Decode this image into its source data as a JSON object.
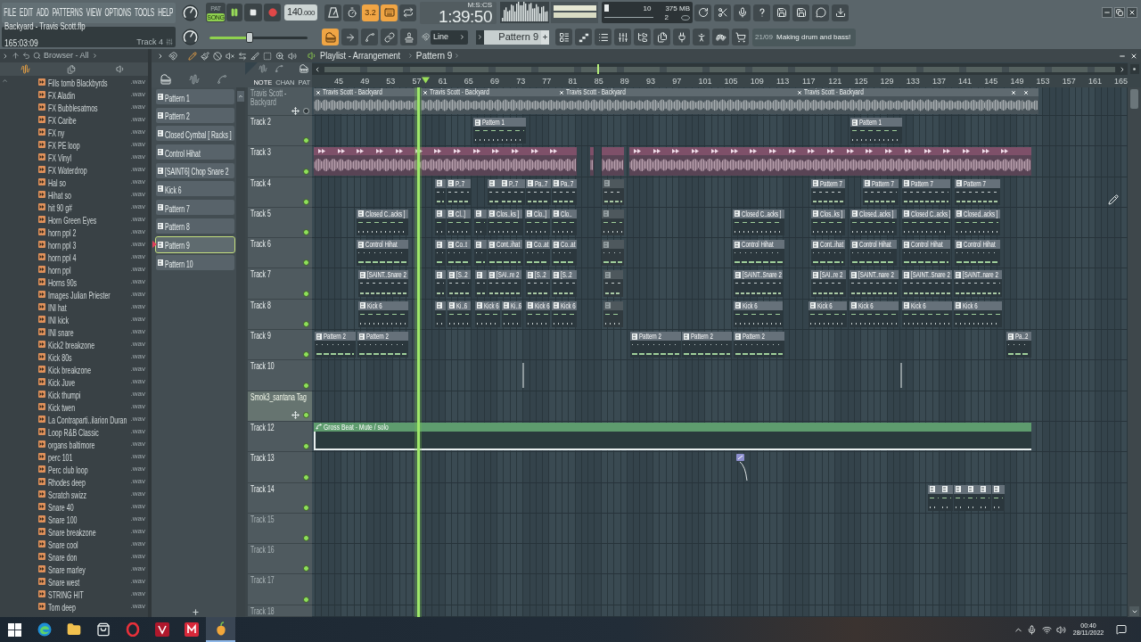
{
  "menu": [
    "FILE",
    "EDIT",
    "ADD",
    "PATTERNS",
    "VIEW",
    "OPTIONS",
    "TOOLS",
    "HELP"
  ],
  "transport": {
    "modes": [
      {
        "label": "PAT",
        "selected": false
      },
      {
        "label": "SONG",
        "selected": true
      }
    ],
    "playing": true,
    "tempo": "140.000"
  },
  "record_toggles": [
    {
      "on": false
    },
    {
      "on": false
    },
    {
      "label": "3.2",
      "on": true
    },
    {
      "on": true
    },
    {
      "on": false
    }
  ],
  "clock": {
    "time": "1:39:50",
    "unit": "M:S:CS"
  },
  "monitor": {
    "cpu": "10",
    "memory": "375 MB",
    "voices": "2"
  },
  "song": {
    "file": "Backyard - Travis Scott.flp",
    "position": "165:03:09",
    "track": "Track 4"
  },
  "pitch": {
    "level": 0.41
  },
  "edit_toggles": [
    {
      "on": true
    },
    {
      "on": false
    },
    {
      "on": false
    },
    {
      "on": false
    },
    {
      "on": false
    }
  ],
  "snap": {
    "value": "Line"
  },
  "pattern_selector": {
    "value": "Pattern 9"
  },
  "hint": {
    "counter": "21/09",
    "text": "Making drum and bass!"
  },
  "browser": {
    "title": "Browser - All",
    "items": [
      {
        "name": "Fills tomb Blackbyrds",
        "ext": ".wav"
      },
      {
        "name": "FX Aladin",
        "ext": ".wav"
      },
      {
        "name": "FX Bubblesatmos",
        "ext": ".wav"
      },
      {
        "name": "FX Caribe",
        "ext": ".wav"
      },
      {
        "name": "FX ny",
        "ext": ".wav"
      },
      {
        "name": "FX PE loop",
        "ext": ".wav"
      },
      {
        "name": "FX Vinyl",
        "ext": ".wav"
      },
      {
        "name": "FX Waterdrop",
        "ext": ".wav"
      },
      {
        "name": "Hal so",
        "ext": ".wav"
      },
      {
        "name": "Hihat so",
        "ext": ".wav"
      },
      {
        "name": "hit 90 g#",
        "ext": ".wav"
      },
      {
        "name": "Horn Green Eyes",
        "ext": ".wav"
      },
      {
        "name": "horn ppl 2",
        "ext": ".wav"
      },
      {
        "name": "horn ppl 3",
        "ext": ".wav"
      },
      {
        "name": "horn ppl 4",
        "ext": ".wav"
      },
      {
        "name": "horn ppl",
        "ext": ".wav"
      },
      {
        "name": "Horns 90s",
        "ext": ".wav"
      },
      {
        "name": "Images Julian Priester",
        "ext": ".wav"
      },
      {
        "name": "INI hat",
        "ext": ".wav"
      },
      {
        "name": "INI kick",
        "ext": ".wav"
      },
      {
        "name": "INI snare",
        "ext": ".wav"
      },
      {
        "name": "Kick2 breakzone",
        "ext": ".wav"
      },
      {
        "name": "Kick 80s",
        "ext": ".wav"
      },
      {
        "name": "Kick breakzone",
        "ext": ".wav"
      },
      {
        "name": "Kick Juve",
        "ext": ".wav"
      },
      {
        "name": "Kick thumpi",
        "ext": ".wav"
      },
      {
        "name": "Kick twen",
        "ext": ".wav"
      },
      {
        "name": "La Contraparti..ilarion Duran",
        "ext": ".wav"
      },
      {
        "name": "Loop R&B Classic",
        "ext": ".wav"
      },
      {
        "name": "organs baltimore",
        "ext": ".wav"
      },
      {
        "name": "perc 101",
        "ext": ".wav"
      },
      {
        "name": "Perc club loop",
        "ext": ".wav"
      },
      {
        "name": "Rhodes deep",
        "ext": ".wav"
      },
      {
        "name": "Scratch swizz",
        "ext": ".wav"
      },
      {
        "name": "Snare 40",
        "ext": ".wav"
      },
      {
        "name": "Snare 100",
        "ext": ".wav"
      },
      {
        "name": "Snare breakzone",
        "ext": ".wav"
      },
      {
        "name": "Snare cool",
        "ext": ".wav"
      },
      {
        "name": "Snare don",
        "ext": ".wav"
      },
      {
        "name": "Snare marley",
        "ext": ".wav"
      },
      {
        "name": "Snare west",
        "ext": ".wav"
      },
      {
        "name": "STRING HIT",
        "ext": ".wav"
      },
      {
        "name": "Tom deep",
        "ext": ".wav"
      }
    ]
  },
  "playlist": {
    "title": "Playlist - Arrangement",
    "pattern": "Pattern 9",
    "patterns": [
      {
        "name": "Pattern 1",
        "selected": false
      },
      {
        "name": "Pattern 2",
        "selected": false
      },
      {
        "name": "Closed Cymbal [ Racks ]",
        "selected": false
      },
      {
        "name": "Control Hihat",
        "selected": false
      },
      {
        "name": "[SAINT6] Chop Snare 2",
        "selected": false
      },
      {
        "name": "Kick 6",
        "selected": false
      },
      {
        "name": "Pattern 7",
        "selected": false
      },
      {
        "name": "Pattern 8",
        "selected": false
      },
      {
        "name": "Pattern 9",
        "selected": true
      },
      {
        "name": "Pattern 10",
        "selected": false
      }
    ],
    "modes": [
      {
        "label": "NOTE",
        "selected": true
      },
      {
        "label": "CHAN",
        "selected": false
      },
      {
        "label": "PAT",
        "selected": false
      }
    ],
    "ruler": [
      "45",
      "49",
      "53",
      "57",
      "61",
      "65",
      "69",
      "73",
      "77",
      "81",
      "85",
      "89",
      "93",
      "97",
      "101",
      "105",
      "109",
      "113",
      "117",
      "121",
      "125",
      "129",
      "133",
      "137",
      "141",
      "145",
      "149",
      "153",
      "157",
      "161",
      "165"
    ],
    "tracks": [
      {
        "name": "Travis Scott - Backyard",
        "dimmed": true,
        "selected": false,
        "enabled": false,
        "handle": true,
        "clips": [
          {
            "kind": "audio",
            "color": "#5f6a70",
            "label": "Travis Scott - Backyard"
          },
          {
            "kind": "audio",
            "color": "#5f6a70",
            "label": "Travis Scott - Backyard"
          },
          {
            "kind": "audio",
            "color": "#5f6a70",
            "label": "Travis Scott - Backyard"
          },
          {
            "kind": "audio",
            "color": "#5f6a70",
            "label": "Travis Scott - Backyard"
          },
          {
            "kind": "audio",
            "color": "#5f6a70"
          },
          {
            "kind": "audio",
            "color": "#5f6a70"
          }
        ]
      },
      {
        "name": "Track 2",
        "dimmed": false,
        "selected": false,
        "enabled": true,
        "handle": false,
        "clips": [
          {
            "kind": "pattern",
            "label": "Pattern 1",
            "muted": false
          },
          {
            "kind": "pattern",
            "label": "Pattern 1",
            "muted": false
          }
        ]
      },
      {
        "name": "Track 3",
        "dimmed": false,
        "selected": false,
        "enabled": true,
        "handle": false,
        "clips": [
          {
            "kind": "sliced",
            "color": "#7e5069"
          },
          {
            "kind": "sliced",
            "color": "#7e5069"
          },
          {
            "kind": "sliced",
            "color": "#7e5069"
          },
          {
            "kind": "sliced",
            "color": "#7e5069"
          }
        ]
      },
      {
        "name": "Track 4",
        "dimmed": false,
        "selected": false,
        "enabled": true,
        "handle": false,
        "clips": [
          {
            "kind": "pattern",
            "muted": false
          },
          {
            "kind": "pattern",
            "label": "P..7",
            "muted": false
          },
          {
            "kind": "pattern",
            "muted": false
          },
          {
            "kind": "pattern",
            "label": "P..7",
            "muted": false
          },
          {
            "kind": "pattern",
            "label": "Pa..7",
            "muted": false
          },
          {
            "kind": "pattern",
            "label": "Pa..7",
            "muted": false
          },
          {
            "kind": "pattern",
            "muted": true
          },
          {
            "kind": "pattern",
            "label": "Pattern 7",
            "muted": false
          },
          {
            "kind": "pattern",
            "label": "Pattern 7",
            "muted": false
          },
          {
            "kind": "pattern",
            "label": "Pattern 7",
            "muted": false
          },
          {
            "kind": "pattern",
            "label": "Pattern 7",
            "muted": false
          }
        ]
      },
      {
        "name": "Track 5",
        "dimmed": false,
        "selected": false,
        "enabled": true,
        "handle": false,
        "clips": [
          {
            "kind": "pattern",
            "label": "Closed C..acks ]",
            "muted": false
          },
          {
            "kind": "pattern",
            "muted": false
          },
          {
            "kind": "pattern",
            "label": "Cl..]",
            "muted": false
          },
          {
            "kind": "pattern",
            "muted": false
          },
          {
            "kind": "pattern",
            "label": "Clos..ks ]",
            "muted": false
          },
          {
            "kind": "pattern",
            "label": "Clo..]",
            "muted": false
          },
          {
            "kind": "pattern",
            "label": "Clo..",
            "muted": false
          },
          {
            "kind": "pattern",
            "muted": true
          },
          {
            "kind": "pattern",
            "label": "Closed C..acks ]",
            "muted": false
          },
          {
            "kind": "pattern",
            "label": "Clos..ks ]",
            "muted": false
          },
          {
            "kind": "pattern",
            "label": "Closed..acks ]",
            "muted": false
          },
          {
            "kind": "pattern",
            "label": "Closed C..acks ]",
            "muted": false
          },
          {
            "kind": "pattern",
            "label": "Closed..acks ]",
            "muted": false
          }
        ]
      },
      {
        "name": "Track 6",
        "dimmed": false,
        "selected": false,
        "enabled": true,
        "handle": false,
        "clips": [
          {
            "kind": "pattern",
            "label": "Control Hihat",
            "muted": false
          },
          {
            "kind": "pattern",
            "muted": false
          },
          {
            "kind": "pattern",
            "label": "Co..t",
            "muted": false
          },
          {
            "kind": "pattern",
            "muted": false
          },
          {
            "kind": "pattern",
            "label": "Cont..ihat",
            "muted": false
          },
          {
            "kind": "pattern",
            "label": "Co..at",
            "muted": false
          },
          {
            "kind": "pattern",
            "label": "Co..at",
            "muted": false
          },
          {
            "kind": "pattern",
            "muted": true
          },
          {
            "kind": "pattern",
            "label": "Control Hihat",
            "muted": false
          },
          {
            "kind": "pattern",
            "label": "Cont..ihat",
            "muted": false
          },
          {
            "kind": "pattern",
            "label": "Control Hihat",
            "muted": false
          },
          {
            "kind": "pattern",
            "label": "Control Hihat",
            "muted": false
          },
          {
            "kind": "pattern",
            "label": "Control Hihat",
            "muted": false
          }
        ]
      },
      {
        "name": "Track 7",
        "dimmed": false,
        "selected": false,
        "enabled": true,
        "handle": false,
        "clips": [
          {
            "kind": "pattern",
            "label": "[SAINT..Snare 2",
            "muted": false
          },
          {
            "kind": "pattern",
            "muted": false
          },
          {
            "kind": "pattern",
            "label": "[S..2",
            "muted": false
          },
          {
            "kind": "pattern",
            "muted": false
          },
          {
            "kind": "pattern",
            "label": "[SAI..re 2",
            "muted": false
          },
          {
            "kind": "pattern",
            "label": "[S..2",
            "muted": false
          },
          {
            "kind": "pattern",
            "label": "[S..2",
            "muted": false
          },
          {
            "kind": "pattern",
            "muted": true
          },
          {
            "kind": "pattern",
            "label": "[SAINT..Snare 2",
            "muted": false
          },
          {
            "kind": "pattern",
            "label": "[SAI..re 2",
            "muted": false
          },
          {
            "kind": "pattern",
            "label": "[SAINT..nare 2",
            "muted": false
          },
          {
            "kind": "pattern",
            "label": "[SAINT..Snare 2",
            "muted": false
          },
          {
            "kind": "pattern",
            "label": "[SAINT..nare 2",
            "muted": false
          }
        ]
      },
      {
        "name": "Track 8",
        "dimmed": false,
        "selected": false,
        "enabled": true,
        "handle": false,
        "clips": [
          {
            "kind": "pattern",
            "label": "Kick 6",
            "muted": false
          },
          {
            "kind": "pattern",
            "muted": false
          },
          {
            "kind": "pattern",
            "label": "Ki..6",
            "muted": false
          },
          {
            "kind": "pattern",
            "label": "Kick 6",
            "muted": false
          },
          {
            "kind": "pattern",
            "label": "Ki..6",
            "muted": false
          },
          {
            "kind": "pattern",
            "label": "Kick 6",
            "muted": false
          },
          {
            "kind": "pattern",
            "label": "Kick 6",
            "muted": false
          },
          {
            "kind": "pattern",
            "muted": true
          },
          {
            "kind": "pattern",
            "label": "Kick 6",
            "muted": false
          },
          {
            "kind": "pattern",
            "label": "Kick 6",
            "muted": false
          },
          {
            "kind": "pattern",
            "label": "Kick 6",
            "muted": false
          },
          {
            "kind": "pattern",
            "label": "Kick 6",
            "muted": false
          },
          {
            "kind": "pattern",
            "label": "Kick 6",
            "muted": false
          }
        ]
      },
      {
        "name": "Track 9",
        "dimmed": false,
        "selected": false,
        "enabled": true,
        "handle": false,
        "clips": [
          {
            "kind": "pattern",
            "label": "Pattern 2",
            "muted": false
          },
          {
            "kind": "pattern",
            "label": "Pattern 2",
            "muted": false
          },
          {
            "kind": "pattern",
            "label": "Pattern 2",
            "muted": false
          },
          {
            "kind": "pattern",
            "label": "Pattern 2",
            "muted": false
          },
          {
            "kind": "pattern",
            "label": "Pattern 2",
            "muted": false
          },
          {
            "kind": "pattern",
            "label": "Pa..2",
            "muted": false
          }
        ]
      },
      {
        "name": "Track 10",
        "dimmed": false,
        "selected": false,
        "enabled": true,
        "handle": false,
        "clips": [
          {
            "kind": "thin"
          },
          {
            "kind": "thin"
          }
        ]
      },
      {
        "name": "Smok3_santana Tag",
        "dimmed": false,
        "selected": true,
        "enabled": true,
        "handle": true
      },
      {
        "name": "Track 12",
        "dimmed": false,
        "selected": false,
        "enabled": true,
        "handle": false,
        "clips": [
          {
            "kind": "automation",
            "color": "#5e9c6e",
            "label": "Gross Beat - Mute / solo"
          }
        ]
      },
      {
        "name": "Track 13",
        "dimmed": false,
        "selected": false,
        "enabled": true,
        "handle": false,
        "clips": [
          {
            "kind": "curve"
          }
        ]
      },
      {
        "name": "Track 14",
        "dimmed": false,
        "selected": false,
        "enabled": true,
        "handle": false,
        "clips": [
          {
            "kind": "pattern",
            "muted": false
          },
          {
            "kind": "pattern",
            "muted": false
          },
          {
            "kind": "pattern",
            "muted": false
          },
          {
            "kind": "pattern",
            "muted": false
          },
          {
            "kind": "pattern",
            "muted": false
          },
          {
            "kind": "pattern",
            "muted": false
          }
        ]
      },
      {
        "name": "Track 15",
        "dimmed": true,
        "selected": false,
        "enabled": true,
        "handle": false
      },
      {
        "name": "Track 16",
        "dimmed": true,
        "selected": false,
        "enabled": true,
        "handle": false
      },
      {
        "name": "Track 17",
        "dimmed": true,
        "selected": false,
        "enabled": true,
        "handle": false
      },
      {
        "name": "Track 18",
        "dimmed": true,
        "selected": false,
        "handle": false
      }
    ]
  },
  "taskbar": {
    "apps": [
      {
        "active": false
      },
      {
        "active": false
      },
      {
        "active": false
      },
      {
        "active": false
      },
      {
        "active": false
      },
      {
        "active": false
      },
      {
        "active": false
      },
      {
        "active": true
      }
    ],
    "time": "00:40",
    "date": "28/11/2022"
  }
}
